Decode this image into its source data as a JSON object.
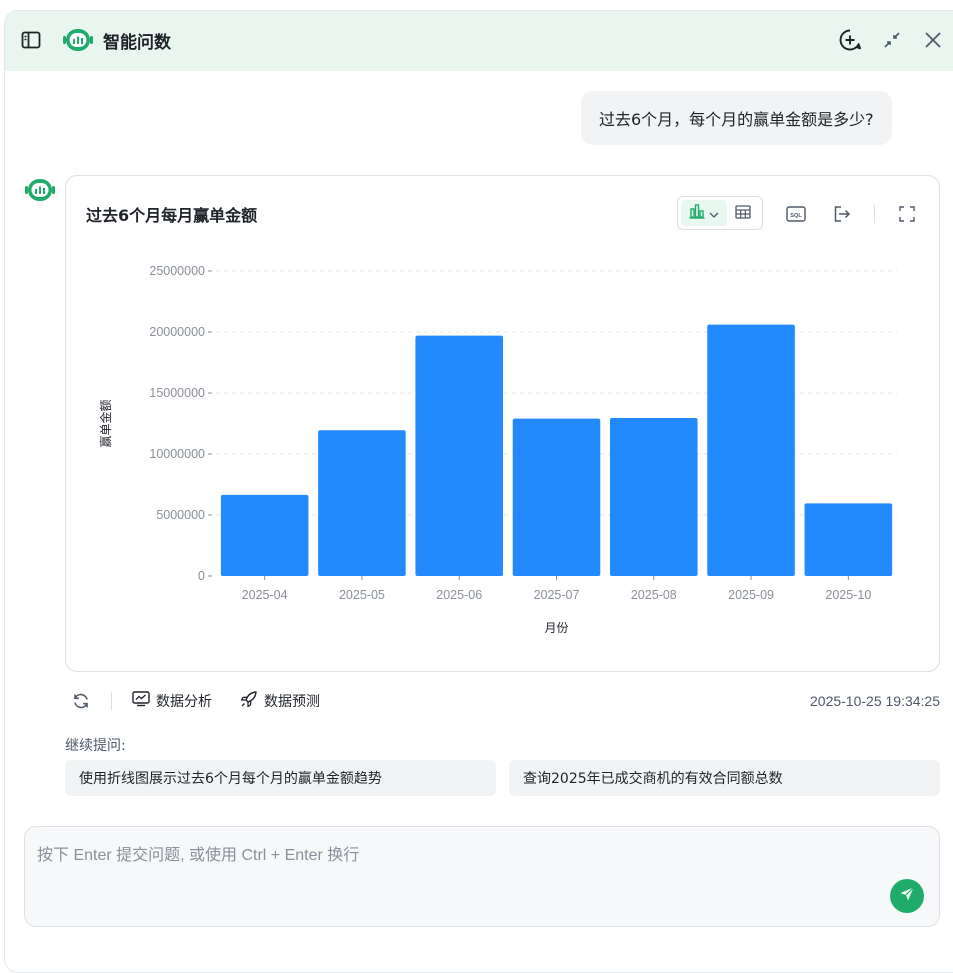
{
  "header": {
    "title": "智能问数",
    "icons": {
      "sidebar": "sidebar-toggle-icon",
      "logo": "robot-logo-icon",
      "new_chat": "plus-circle-icon",
      "shrink": "shrink-icon",
      "close": "close-icon"
    },
    "bg_color": "#e9f6ef"
  },
  "conversation": {
    "user_question": "过去6个月，每个月的赢单金额是多少?",
    "answer": {
      "chart_title": "过去6个月每月赢单金额",
      "toolbar": {
        "sql_label": "SQL",
        "icons": [
          "bar-chart-icon",
          "chevron-down-icon",
          "table-icon",
          "sql-icon",
          "export-icon",
          "fullscreen-icon"
        ]
      }
    },
    "actions": {
      "analyze_label": "数据分析",
      "predict_label": "数据预测",
      "timestamp": "2025-10-25 19:34:25"
    },
    "continue_label": "继续提问:",
    "suggestions": [
      "使用折线图展示过去6个月每个月的赢单金额趋势",
      "查询2025年已成交商机的有效合同额总数"
    ]
  },
  "input": {
    "placeholder": "按下 Enter 提交问题, 或使用 Ctrl + Enter 换行",
    "value": ""
  },
  "colors": {
    "accent": "#1fab6a",
    "bar": "#2389ff"
  },
  "chart_data": {
    "type": "bar",
    "categories": [
      "2025-04",
      "2025-05",
      "2025-06",
      "2025-07",
      "2025-08",
      "2025-09",
      "2025-10"
    ],
    "values": [
      6650000,
      11950000,
      19700000,
      12900000,
      12950000,
      20600000,
      5950000
    ],
    "xlabel": "月份",
    "ylabel": "赢单金额",
    "ylim": [
      0,
      25000000
    ],
    "yticks": [
      0,
      5000000,
      10000000,
      15000000,
      20000000,
      25000000
    ],
    "ytick_labels": [
      "0",
      "5000000",
      "10000000",
      "15000000",
      "20000000",
      "25000000"
    ],
    "grid": "horizontal-dashed",
    "legend": "none"
  }
}
